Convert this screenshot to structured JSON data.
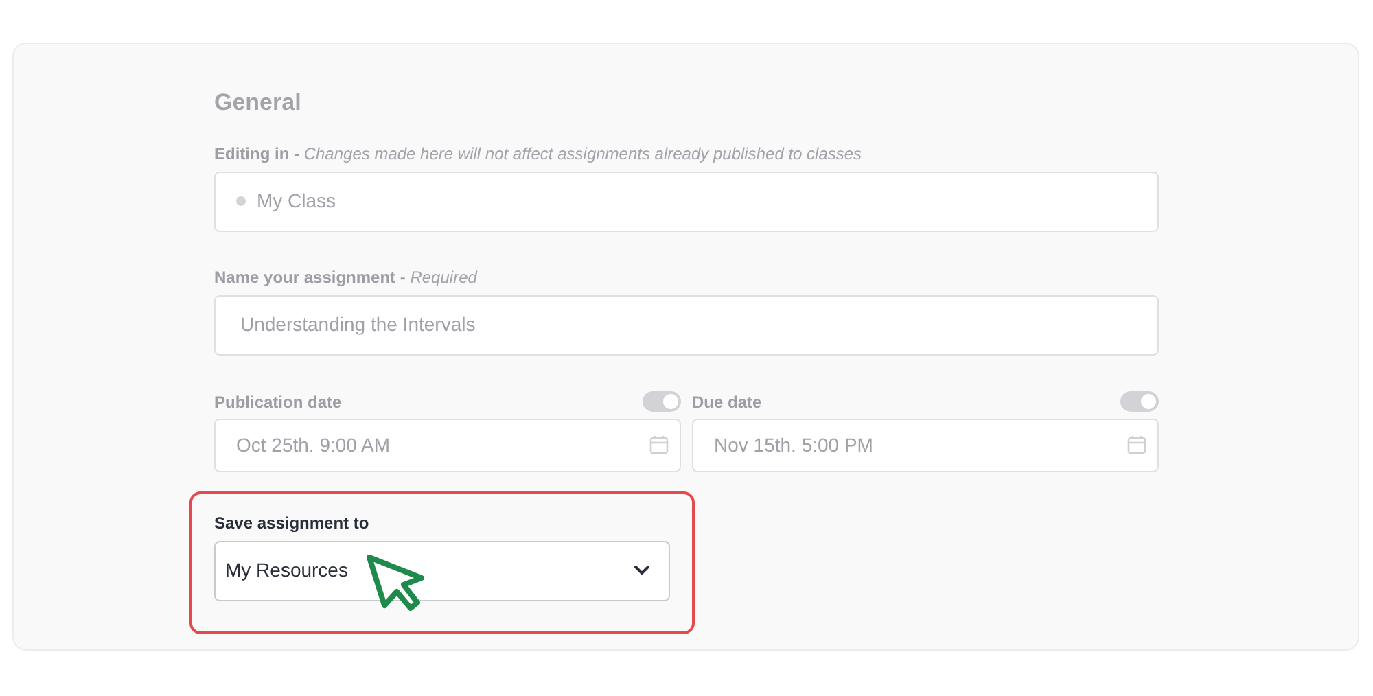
{
  "general": {
    "title": "General",
    "disabled": true,
    "editing_in": {
      "label": "Editing in -",
      "note": "Changes made here will not affect assignments already published to classes",
      "value": "My Class"
    },
    "name": {
      "label": "Name your assignment -",
      "note": "Required",
      "value": "Understanding the Intervals"
    },
    "dates": [
      {
        "label": "Publication date",
        "on": true,
        "value": "Oct 25th. 9:00 AM"
      },
      {
        "label": "Due date",
        "on": true,
        "value": "Nov 15th. 5:00 PM"
      }
    ]
  },
  "save_to": {
    "label": "Save assignment to",
    "value": "My Resources",
    "highlighted": true
  }
}
